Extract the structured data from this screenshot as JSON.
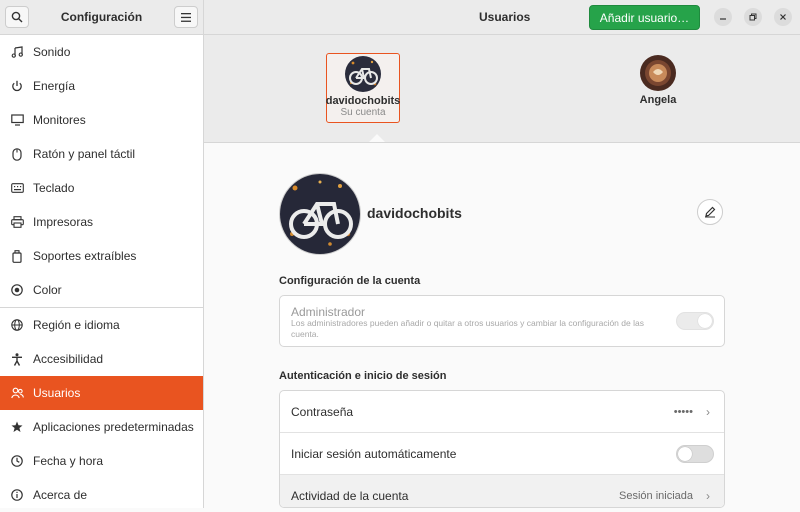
{
  "sidebar": {
    "title": "Configuración",
    "items": [
      {
        "label": "Sonido",
        "icon": "music-note-icon"
      },
      {
        "label": "Energía",
        "icon": "power-icon"
      },
      {
        "label": "Monitores",
        "icon": "monitor-icon"
      },
      {
        "label": "Ratón y panel táctil",
        "icon": "mouse-icon"
      },
      {
        "label": "Teclado",
        "icon": "keyboard-icon"
      },
      {
        "label": "Impresoras",
        "icon": "printer-icon"
      },
      {
        "label": "Soportes extraíbles",
        "icon": "removable-media-icon"
      },
      {
        "label": "Color",
        "icon": "color-icon"
      },
      {
        "label": "Región e idioma",
        "icon": "globe-icon"
      },
      {
        "label": "Accesibilidad",
        "icon": "accessibility-icon"
      },
      {
        "label": "Usuarios",
        "icon": "users-icon",
        "active": true
      },
      {
        "label": "Aplicaciones predeterminadas",
        "icon": "star-icon"
      },
      {
        "label": "Fecha y hora",
        "icon": "clock-icon"
      },
      {
        "label": "Acerca de",
        "icon": "info-icon"
      }
    ]
  },
  "header": {
    "title": "Usuarios",
    "add_user_label": "Añadir usuario…"
  },
  "users": [
    {
      "name": "davidochobits",
      "subtitle": "Su cuenta"
    },
    {
      "name": "Angela",
      "subtitle": ""
    }
  ],
  "profile": {
    "name": "davidochobits"
  },
  "account_settings": {
    "title": "Configuración de la cuenta",
    "admin_label": "Administrador",
    "admin_description": "Los administradores pueden añadir o quitar a otros usuarios y cambiar la configuración de las cuenta.",
    "admin_enabled": true
  },
  "auth": {
    "title": "Autenticación e inicio de sesión",
    "password_label": "Contraseña",
    "password_value": "•••••",
    "autologin_label": "Iniciar sesión automáticamente",
    "autologin_enabled": false,
    "activity_label": "Actividad de la cuenta",
    "activity_value": "Sesión iniciada"
  },
  "colors": {
    "accent": "#e95420",
    "add_button": "#26a34a"
  }
}
